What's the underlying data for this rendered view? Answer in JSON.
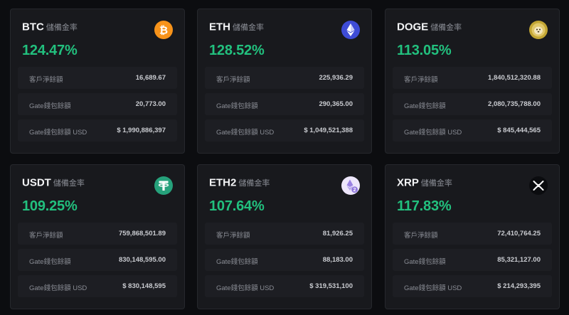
{
  "subtitle": "儲備金率",
  "row_labels": {
    "customer": "客戶淨餘額",
    "wallet": "Gate錢包餘額",
    "wallet_usd": "Gate錢包餘額 USD"
  },
  "colors": {
    "ratio_green": "#22c07e",
    "card_bg": "#18191d",
    "page_bg": "#0c0d10"
  },
  "cards": [
    {
      "symbol": "BTC",
      "ratio": "124.47%",
      "icon": "bitcoin-icon",
      "customer": "16,689.67",
      "wallet": "20,773.00",
      "wallet_usd": "$ 1,990,886,397"
    },
    {
      "symbol": "ETH",
      "ratio": "128.52%",
      "icon": "ethereum-icon",
      "customer": "225,936.29",
      "wallet": "290,365.00",
      "wallet_usd": "$ 1,049,521,388"
    },
    {
      "symbol": "DOGE",
      "ratio": "113.05%",
      "icon": "dogecoin-icon",
      "customer": "1,840,512,320.88",
      "wallet": "2,080,735,788.00",
      "wallet_usd": "$ 845,444,565"
    },
    {
      "symbol": "USDT",
      "ratio": "109.25%",
      "icon": "tether-icon",
      "customer": "759,868,501.89",
      "wallet": "830,148,595.00",
      "wallet_usd": "$ 830,148,595"
    },
    {
      "symbol": "ETH2",
      "ratio": "107.64%",
      "icon": "eth2-icon",
      "customer": "81,926.25",
      "wallet": "88,183.00",
      "wallet_usd": "$ 319,531,100"
    },
    {
      "symbol": "XRP",
      "ratio": "117.83%",
      "icon": "xrp-icon",
      "customer": "72,410,764.25",
      "wallet": "85,321,127.00",
      "wallet_usd": "$ 214,293,395"
    }
  ]
}
